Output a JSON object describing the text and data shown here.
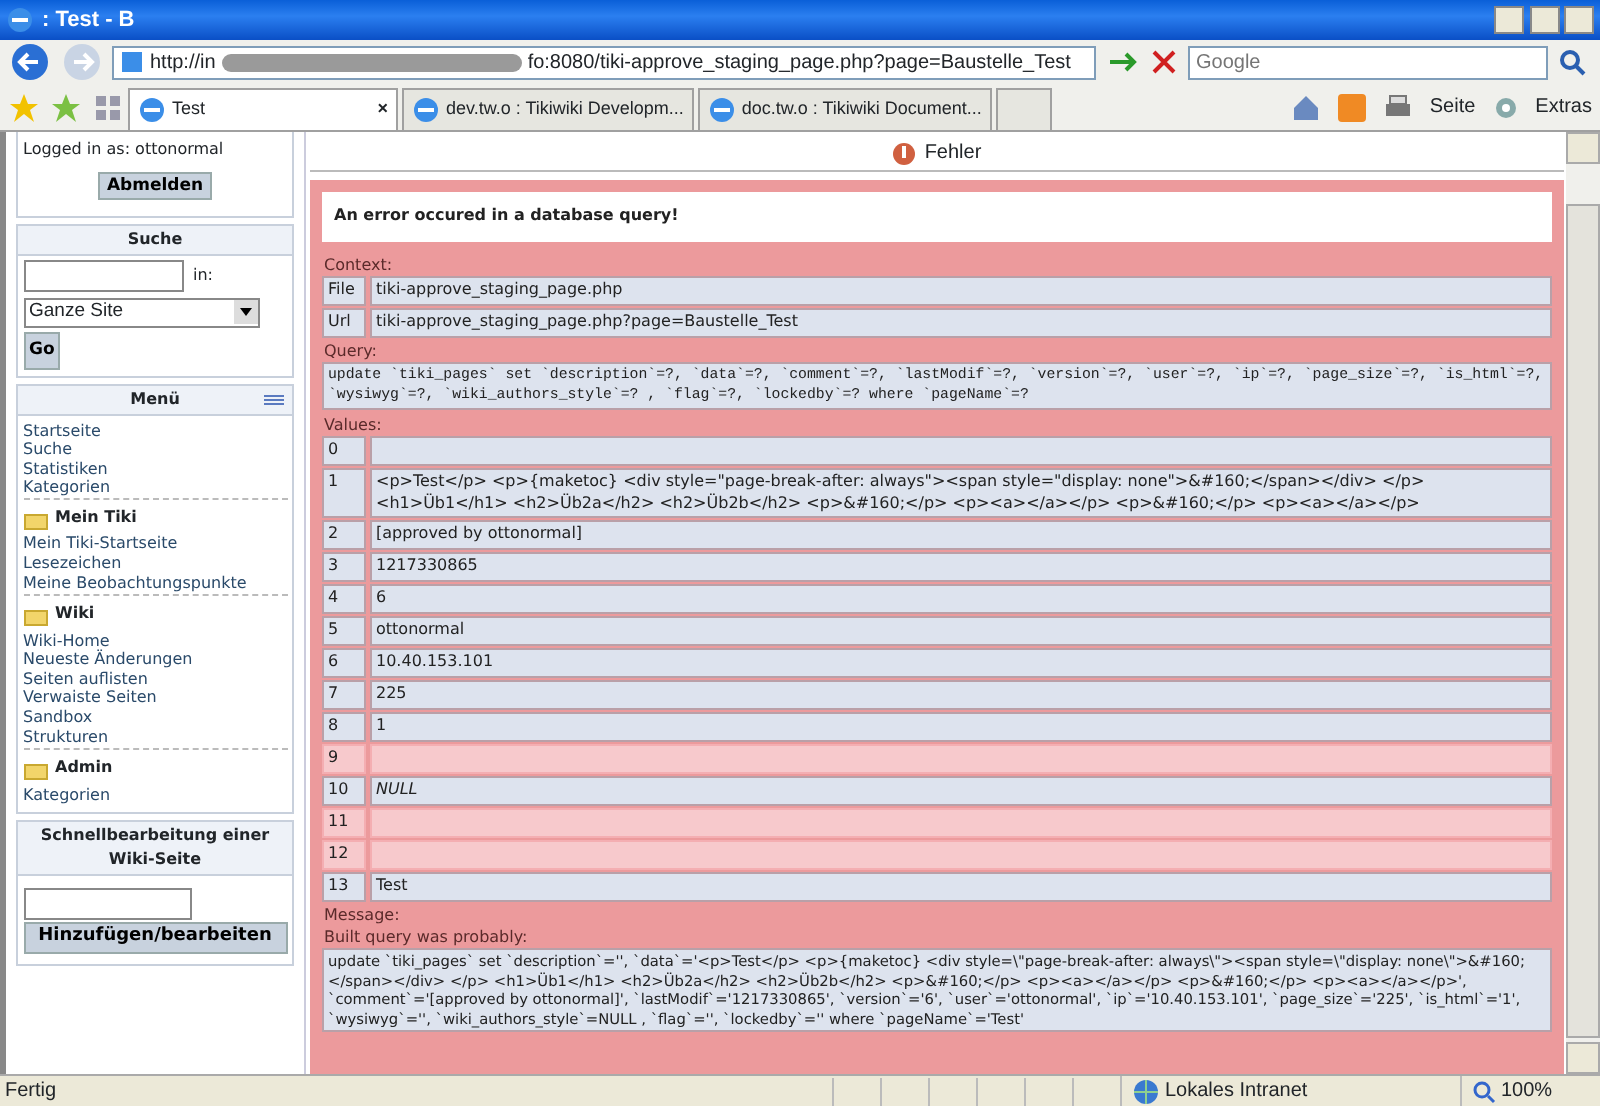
{
  "window": {
    "title": ": Test - B"
  },
  "toolbar": {
    "address_start": "http://in",
    "address_end": "fo:8080/tiki-approve_staging_page.php?page=Baustelle_Test",
    "search_placeholder": "Google"
  },
  "tabs": [
    {
      "label": "Test",
      "selected": true,
      "close_symbol": "×"
    },
    {
      "label": "dev.tw.o : Tikiwiki Developm...",
      "selected": false
    },
    {
      "label": "doc.tw.o : Tikiwiki Document...",
      "selected": false
    }
  ],
  "command_bar": {
    "page": "Seite",
    "tools": "Extras"
  },
  "sidebar": {
    "login": {
      "text": "Logged in as: ottonormal",
      "button": "Abmelden"
    },
    "search": {
      "title": "Suche",
      "in_label": "in:",
      "scope": "Ganze Site",
      "button": "Go"
    },
    "menu": {
      "title": "Menü",
      "sections": [
        {
          "items": [
            "Startseite",
            "Suche",
            "Statistiken",
            "Kategorien"
          ]
        },
        {
          "heading": "Mein Tiki",
          "items": [
            "Mein Tiki-Startseite",
            "Lesezeichen",
            "Meine Beobachtungspunkte"
          ]
        },
        {
          "heading": "Wiki",
          "items": [
            "Wiki-Home",
            "Neueste Änderungen",
            "Seiten auflisten",
            "Verwaiste Seiten",
            "Sandbox",
            "Strukturen"
          ]
        },
        {
          "heading": "Admin",
          "items": [
            "Kategorien"
          ]
        }
      ]
    },
    "quick_edit": {
      "title": "Schnellbearbeitung einer Wiki-Seite",
      "button": "Hinzufügen/bearbeiten"
    }
  },
  "main": {
    "header": "Fehler",
    "error_title": "An error occured in a database query!",
    "context_label": "Context:",
    "context": [
      {
        "key": "File",
        "value": "tiki-approve_staging_page.php"
      },
      {
        "key": "Url",
        "value": "tiki-approve_staging_page.php?page=Baustelle_Test"
      }
    ],
    "query_label": "Query:",
    "query": "update `tiki_pages` set `description`=?, `data`=?, `comment`=?, `lastModif`=?, `version`=?, `user`=?, `ip`=?, `page_size`=?, `is_html`=?, `wysiwyg`=?, `wiki_authors_style`=? , `flag`=?, `lockedby`=? where `pageName`=?",
    "values_label": "Values:",
    "values": [
      {
        "index": "0",
        "flagged": false
      },
      {
        "index": "1",
        "value": "<p>Test</p> <p>{maketoc} <div style=\"page-break-after: always\"><span style=\"display: none\">&#160;</span></div> </p> <h1>Üb1</h1> <h2>Üb2a</h2> <h2>Üb2b</h2> <p>&#160;</p> <p><a></a></p> <p>&#160;</p> <p><a></a></p>",
        "flagged": false
      },
      {
        "index": "2",
        "value": "[approved by ottonormal]",
        "flagged": false
      },
      {
        "index": "3",
        "value": "1217330865",
        "flagged": false
      },
      {
        "index": "4",
        "value": "6",
        "flagged": false
      },
      {
        "index": "5",
        "value": "ottonormal",
        "flagged": false
      },
      {
        "index": "6",
        "value": "10.40.153.101",
        "flagged": false
      },
      {
        "index": "7",
        "value": "225",
        "flagged": false
      },
      {
        "index": "8",
        "value": "1",
        "flagged": false
      },
      {
        "index": "9",
        "flagged": true
      },
      {
        "index": "10",
        "value": "NULL",
        "italic": true,
        "flagged": false
      },
      {
        "index": "11",
        "flagged": true
      },
      {
        "index": "12",
        "flagged": true
      },
      {
        "index": "13",
        "value": "Test",
        "flagged": false
      }
    ],
    "message_label": "Message:",
    "built_label": "Built query was probably:",
    "built_query": "update `tiki_pages` set `description`='', `data`='<p>Test</p> <p>{maketoc} <div style=\\\"page-break-after: always\\\"><span style=\\\"display: none\\\">&#160;</span></div> </p> <h1>Üb1</h1> <h2>Üb2a</h2> <h2>Üb2b</h2> <p>&#160;</p> <p><a></a></p> <p>&#160;</p> <p><a></a></p>', `comment`='[approved by ottonormal]', `lastModif`='1217330865', `version`='6', `user`='ottonormal', `ip`='10.40.153.101', `page_size`='225', `is_html`='1', `wysiwyg`='', `wiki_authors_style`=NULL , `flag`='', `lockedby`='' where `pageName`='Test'"
  },
  "status_bar": {
    "text": "Fertig",
    "zone": "Lokales Intranet",
    "zoom": "100%"
  }
}
